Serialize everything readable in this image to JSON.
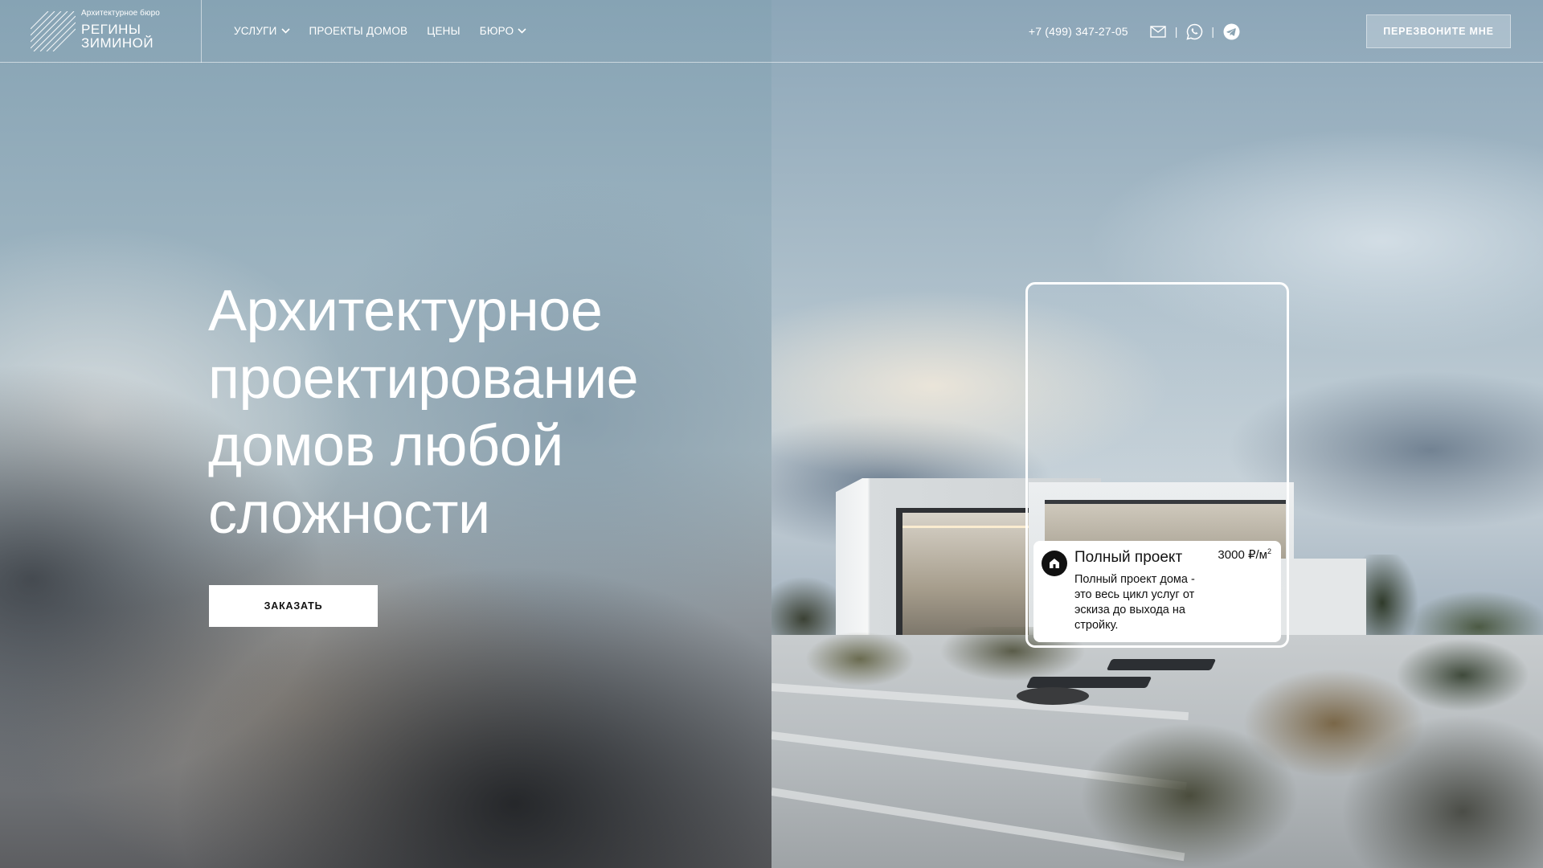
{
  "brand": {
    "caption": "Архитектурное бюро",
    "name_line1": "РЕГИНЫ",
    "name_line2": "ЗИМИНОЙ"
  },
  "nav": {
    "items": [
      {
        "label": "УСЛУГИ",
        "dropdown": true
      },
      {
        "label": "ПРОЕКТЫ ДОМОВ",
        "dropdown": false
      },
      {
        "label": "ЦЕНЫ",
        "dropdown": false
      },
      {
        "label": "БЮРО",
        "dropdown": true
      }
    ]
  },
  "contacts": {
    "phone": "+7 (499) 347-27-05",
    "separator": "|",
    "icons": [
      "mail-icon",
      "whatsapp-icon",
      "telegram-icon"
    ]
  },
  "callback_button": "ПЕРЕЗВОНИТЕ МНЕ",
  "hero": {
    "title_line1": "Архитектурное",
    "title_line2": "проектирование",
    "title_line3": "домов любой",
    "title_line4": "сложности",
    "order_button": "ЗАКАЗАТЬ"
  },
  "promo_card": {
    "icon": "house-icon",
    "title": "Полный проект",
    "price": "3000 ₽/м",
    "price_unit_sup": "2",
    "description": "Полный проект дома - это весь цикл услуг от эскиза до выхода на стройку."
  },
  "colors": {
    "accent": "#ffffff",
    "text_dark": "#111111",
    "sky": "#8aa3b2"
  }
}
